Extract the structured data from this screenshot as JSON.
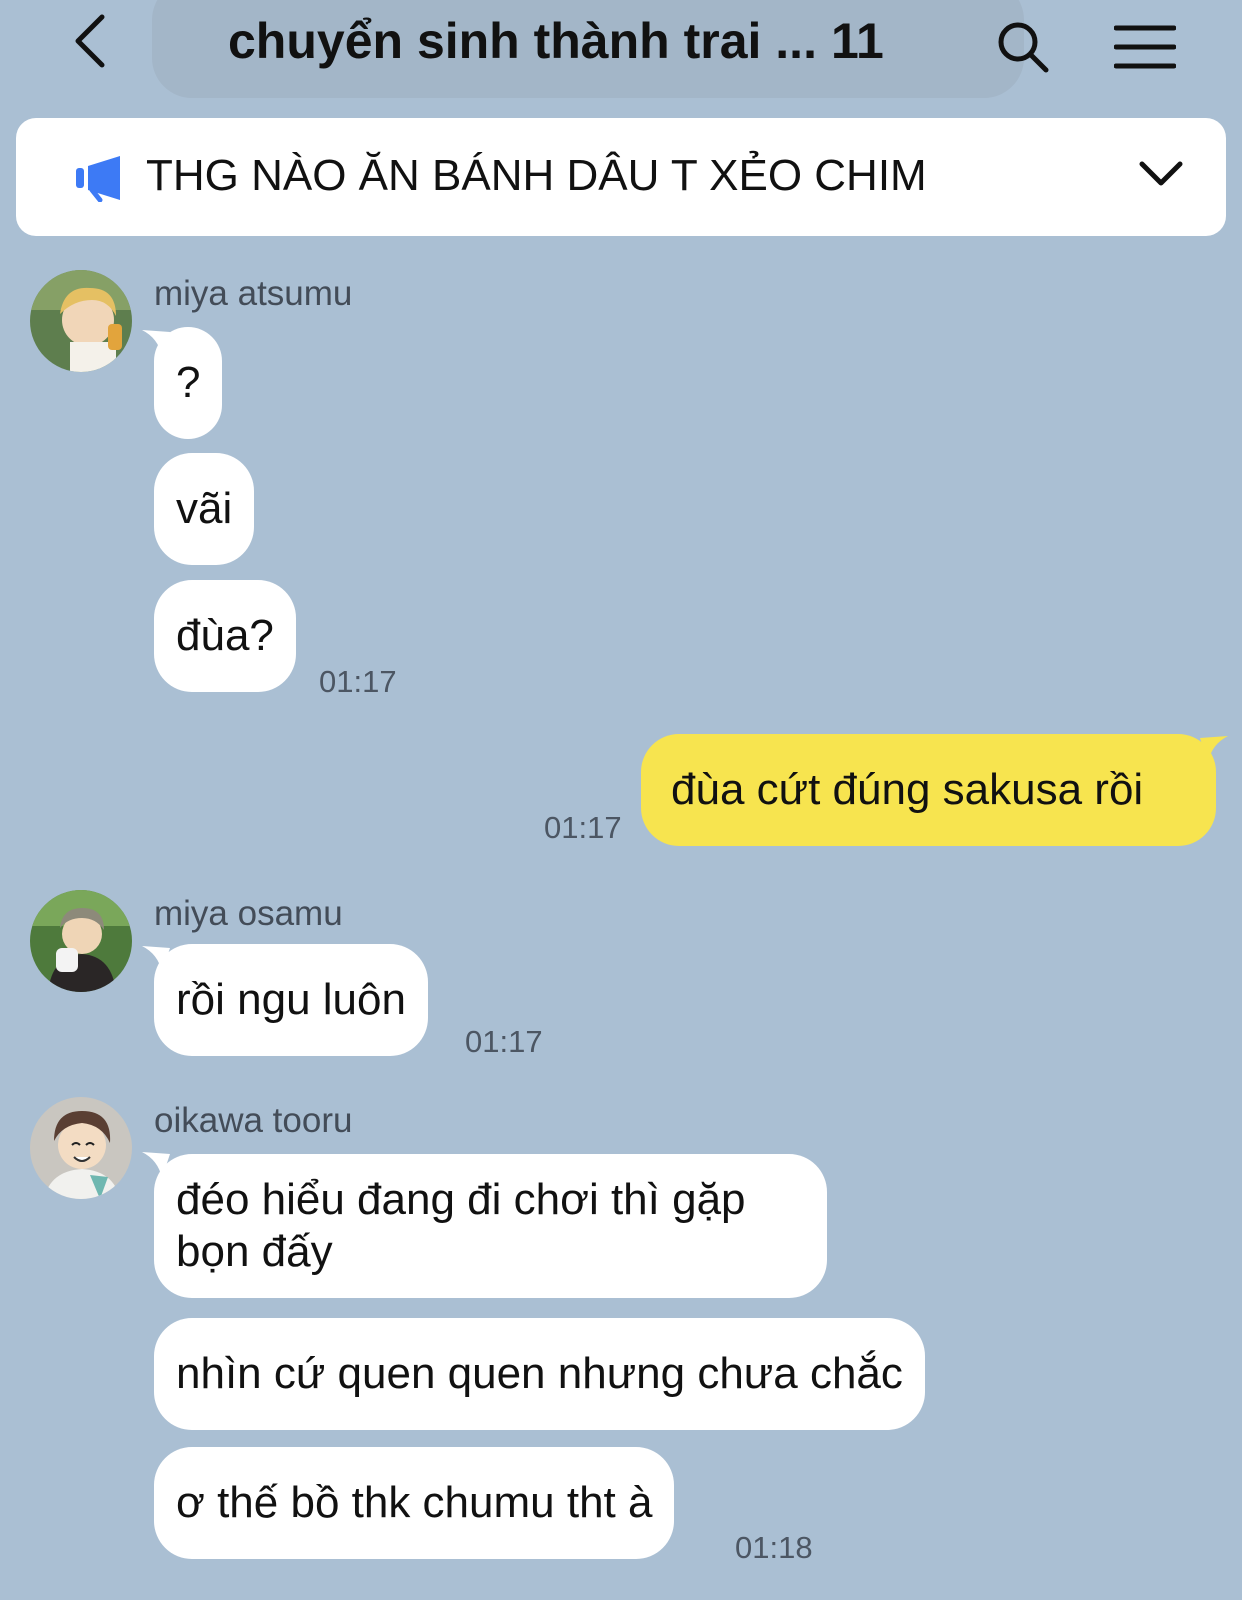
{
  "header": {
    "title": "chuyển sinh thành trai ...",
    "member_count": "11",
    "back_icon": "chevron-left-icon",
    "search_icon": "search-icon",
    "menu_icon": "hamburger-menu-icon"
  },
  "notice": {
    "text": "THG NÀO ĂN BÁNH DÂU T XẺO CHIM",
    "icon": "megaphone-icon",
    "icon_color": "#3d7af5",
    "expand_icon": "chevron-down-icon"
  },
  "colors": {
    "background": "#aabfd3",
    "incoming_bubble": "#ffffff",
    "outgoing_bubble": "#f7e44f"
  },
  "messages": [
    {
      "sender": "miya atsumu",
      "bubbles": [
        "?",
        "vãi",
        "đùa?"
      ],
      "time": "01:17"
    },
    {
      "mine": true,
      "text": "đùa cứt đúng sakusa rồi",
      "time": "01:17"
    },
    {
      "sender": "miya osamu",
      "bubbles": [
        "rồi ngu luôn"
      ],
      "time": "01:17"
    },
    {
      "sender": "oikawa tooru",
      "bubbles": [
        "đéo hiểu đang đi chơi thì gặp bọn đấy",
        "nhìn cứ quen quen nhưng chưa chắc",
        "ơ thế bồ thk chumu tht à"
      ],
      "time": "01:18"
    }
  ]
}
